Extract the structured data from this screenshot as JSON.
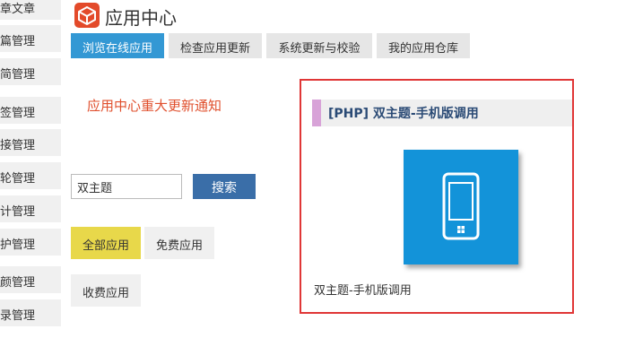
{
  "sidebar": {
    "items": [
      {
        "label": "章文章"
      },
      {
        "label": "篇管理"
      },
      {
        "label": "简管理"
      },
      {
        "label": "签管理"
      },
      {
        "label": "接管理"
      },
      {
        "label": "轮管理"
      },
      {
        "label": "计管理"
      },
      {
        "label": "护管理"
      },
      {
        "label": "颜管理"
      },
      {
        "label": "录管理"
      }
    ]
  },
  "header": {
    "title": "应用中心",
    "logo_icon": "cube-logo-icon"
  },
  "tabs": [
    {
      "label": "浏览在线应用",
      "active": true
    },
    {
      "label": "检查应用更新",
      "active": false
    },
    {
      "label": "系统更新与校验",
      "active": false
    },
    {
      "label": "我的应用仓库",
      "active": false
    }
  ],
  "notice": {
    "text": "应用中心重大更新通知"
  },
  "search": {
    "value": "双主题",
    "button_label": "搜索"
  },
  "filters": [
    {
      "label": "全部应用",
      "active": true
    },
    {
      "label": "免费应用",
      "active": false
    },
    {
      "label": "收费应用",
      "active": false
    }
  ],
  "app_card": {
    "header": "[PHP] 双主题-手机版调用",
    "icon": "smartphone-icon",
    "name": "双主题-手机版调用"
  },
  "colors": {
    "tab_active": "#3398d4",
    "notice": "#e0502e",
    "search_button": "#3a6ea8",
    "filter_active": "#e8d84a",
    "card_border": "#e03636",
    "card_header_accent": "#d8a3d8",
    "app_icon_bg": "#1393d9",
    "logo": "#e34a2a"
  }
}
